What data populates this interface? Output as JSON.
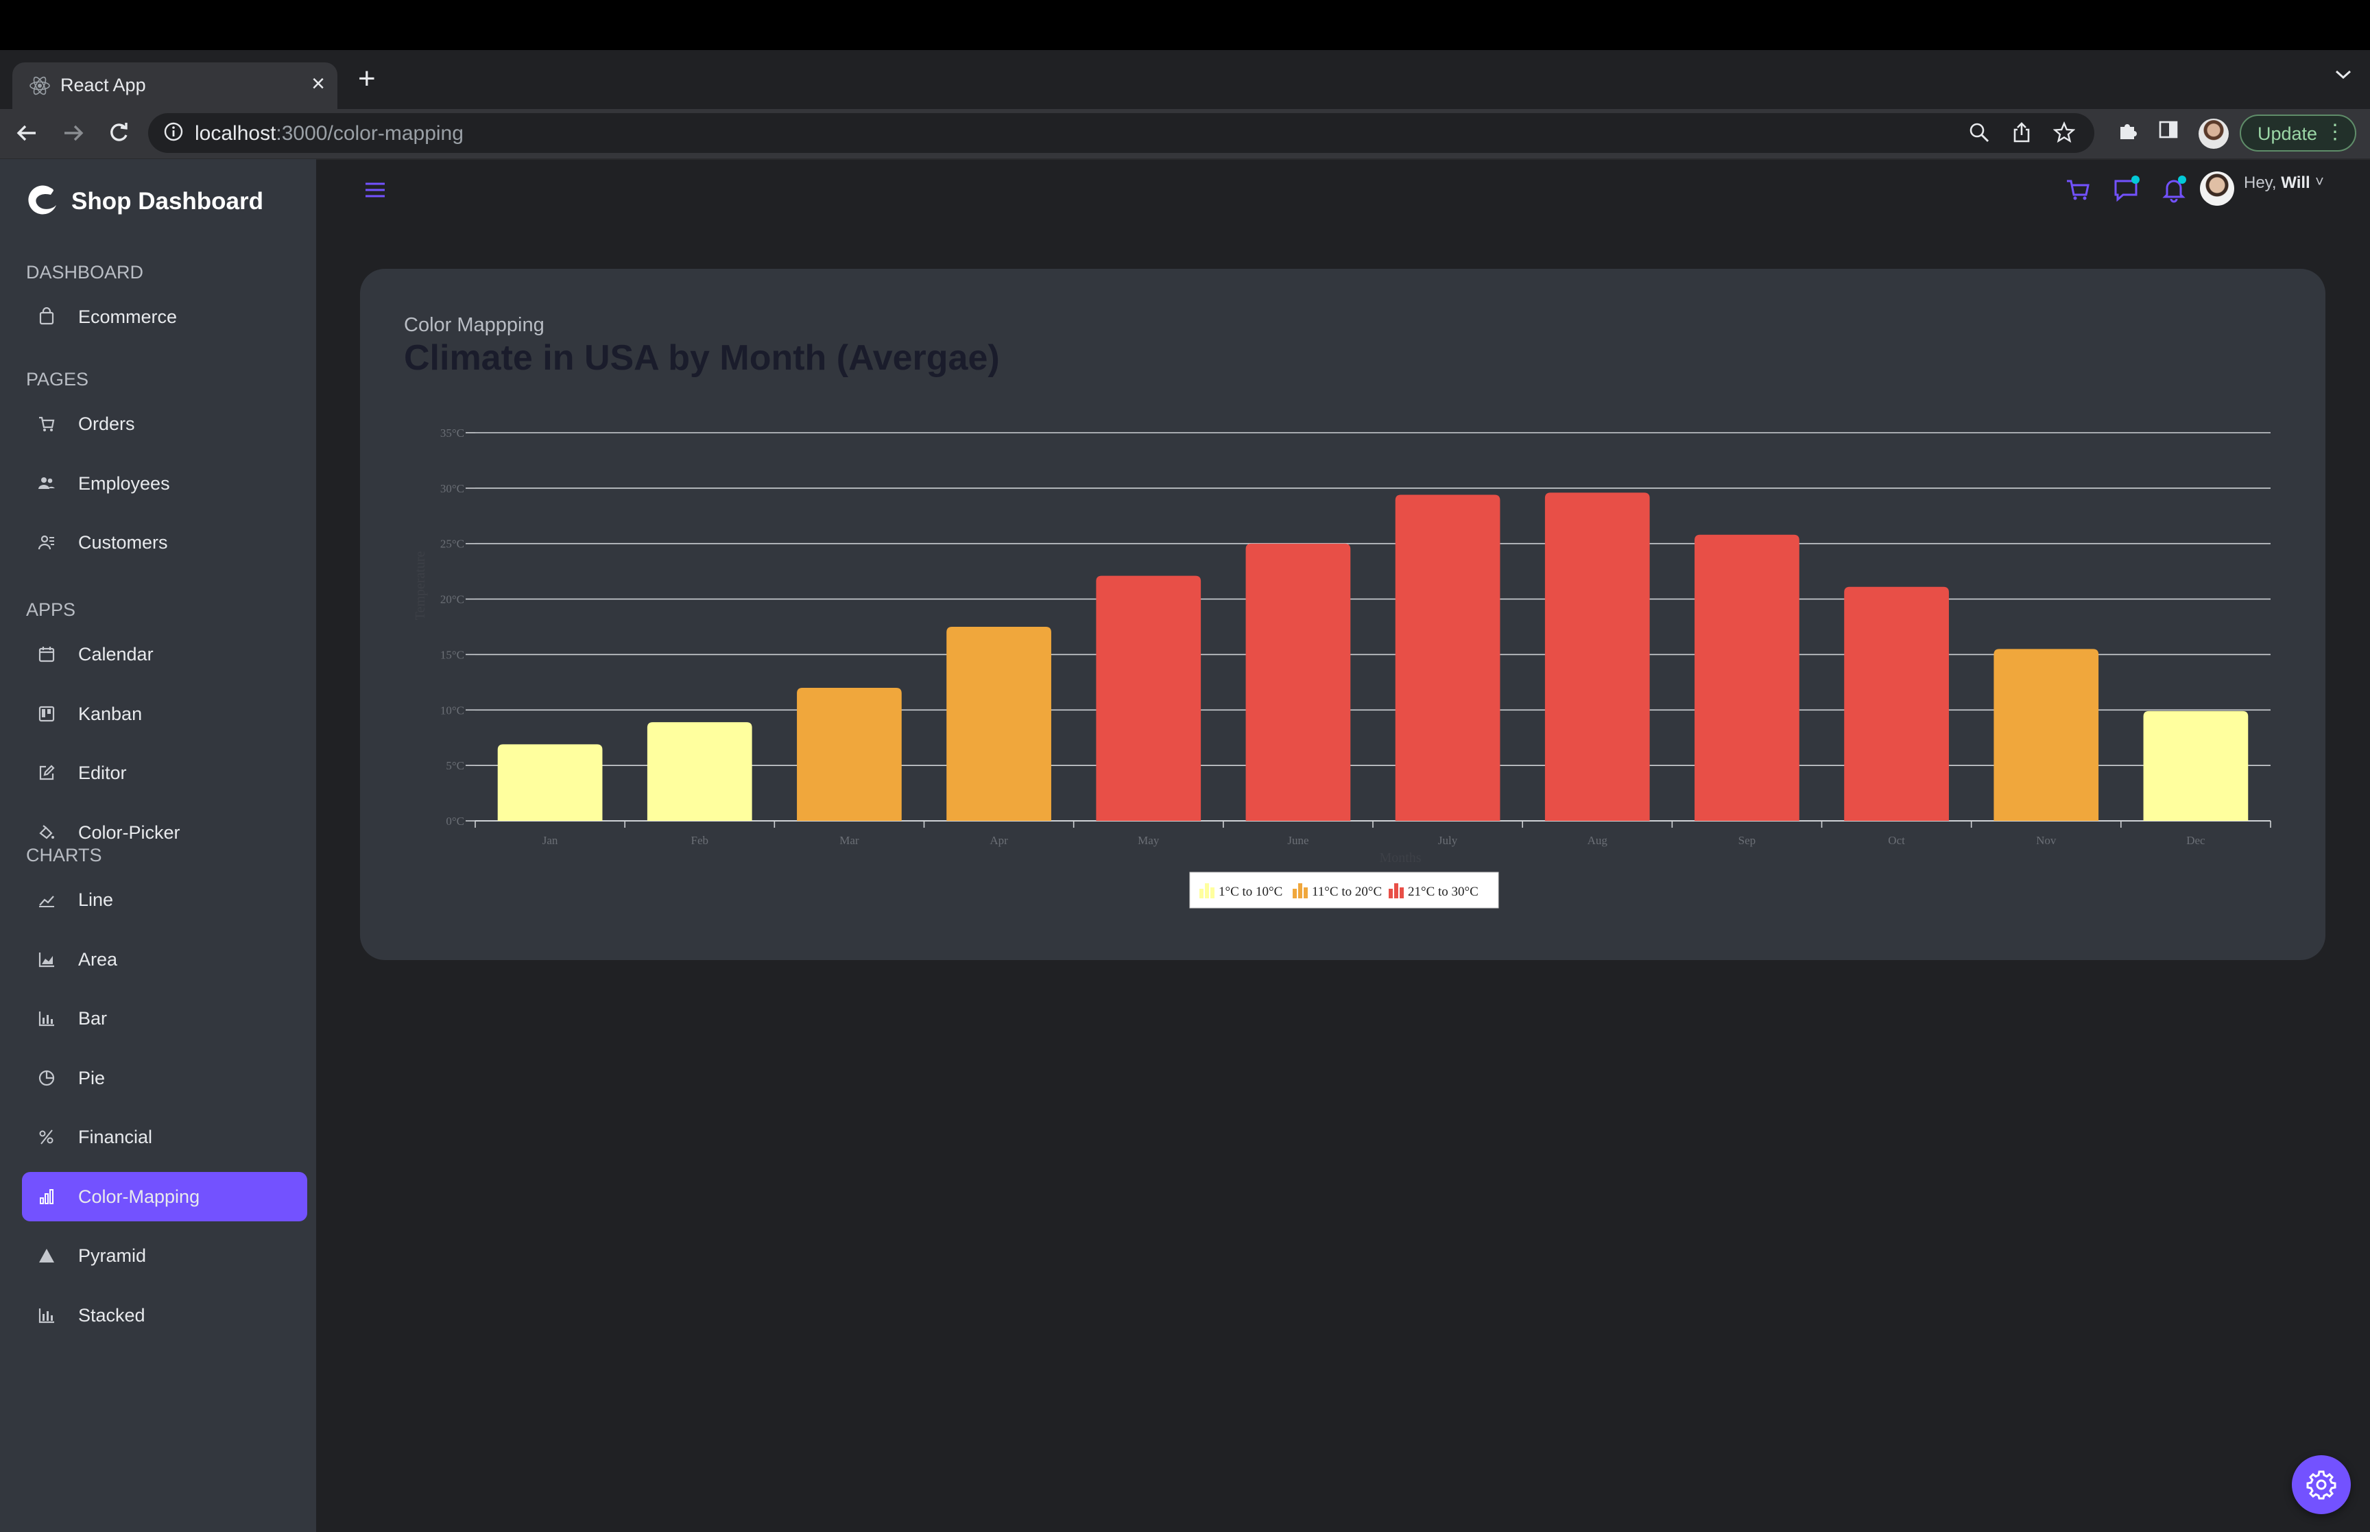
{
  "browser": {
    "tab_title": "React App",
    "url_host": "localhost",
    "url_path": ":3000/color-mapping",
    "update_label": "Update"
  },
  "sidebar": {
    "brand": "Shop Dashboard",
    "sections": [
      {
        "title": "DASHBOARD",
        "items": [
          {
            "label": "Ecommerce",
            "icon": "shopping-bag-icon"
          }
        ]
      },
      {
        "title": "PAGES",
        "items": [
          {
            "label": "Orders",
            "icon": "cart-icon"
          },
          {
            "label": "Employees",
            "icon": "people-icon"
          },
          {
            "label": "Customers",
            "icon": "user-group-icon"
          }
        ]
      },
      {
        "title": "APPS",
        "items": [
          {
            "label": "Calendar",
            "icon": "calendar-icon"
          },
          {
            "label": "Kanban",
            "icon": "kanban-icon"
          },
          {
            "label": "Editor",
            "icon": "edit-icon"
          },
          {
            "label": "Color-Picker",
            "icon": "paint-bucket-icon"
          }
        ]
      },
      {
        "title": "CHARTS",
        "items": [
          {
            "label": "Line",
            "icon": "line-chart-icon"
          },
          {
            "label": "Area",
            "icon": "area-chart-icon"
          },
          {
            "label": "Bar",
            "icon": "bar-chart-icon"
          },
          {
            "label": "Pie",
            "icon": "pie-chart-icon"
          },
          {
            "label": "Financial",
            "icon": "stock-icon"
          },
          {
            "label": "Color-Mapping",
            "icon": "stacked-bar-icon",
            "active": true
          },
          {
            "label": "Pyramid",
            "icon": "pyramid-icon"
          },
          {
            "label": "Stacked",
            "icon": "stacked-chart-icon"
          }
        ]
      }
    ]
  },
  "header": {
    "greeting": "Hey,",
    "user_name": "Will"
  },
  "card": {
    "subtitle": "Color Mappping",
    "title": "Climate in USA by Month (Avergae)"
  },
  "chart_data": {
    "type": "bar",
    "categories": [
      "Jan",
      "Feb",
      "Mar",
      "Apr",
      "May",
      "June",
      "July",
      "Aug",
      "Sep",
      "Oct",
      "Nov",
      "Dec"
    ],
    "values": [
      6.9,
      8.9,
      12,
      17.5,
      22.1,
      25,
      29.4,
      29.6,
      25.8,
      21.1,
      15.5,
      9.9
    ],
    "ylim": [
      0,
      35
    ],
    "yticks": [
      "0°C",
      "5°C",
      "10°C",
      "15°C",
      "20°C",
      "25°C",
      "30°C",
      "35°C"
    ],
    "xlabel": "Months",
    "ylabel": "Temperature",
    "grid": true,
    "legend_position": "bottom",
    "color_ranges": [
      {
        "label": "1°C to 10°C",
        "from": 1,
        "to": 10,
        "color": "#FFFF99"
      },
      {
        "label": "11°C to 20°C",
        "from": 11,
        "to": 20,
        "color": "#FFA500"
      },
      {
        "label": "21°C to 30°C",
        "from": 21,
        "to": 30,
        "color": "#FF4040"
      }
    ]
  },
  "colors": {
    "accent": "#7352ff",
    "bg": "#202124",
    "panel": "#33373e"
  }
}
